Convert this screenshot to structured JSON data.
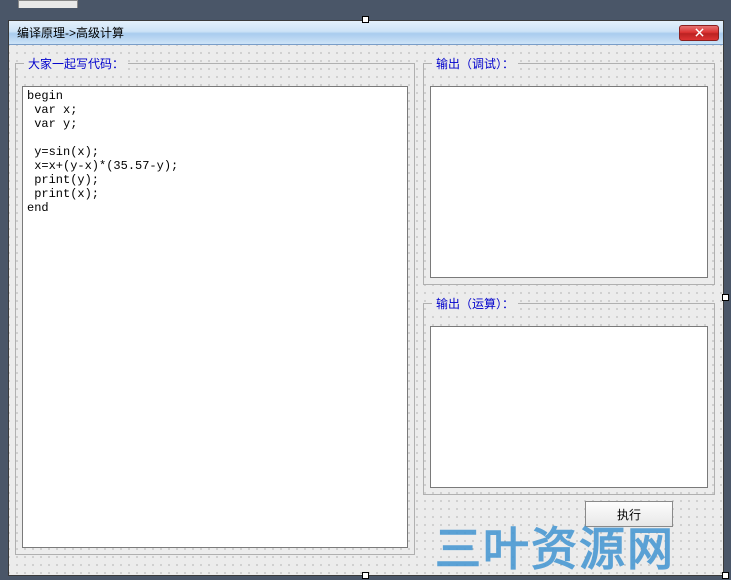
{
  "window": {
    "title": "编译原理->高级计算"
  },
  "groups": {
    "code": {
      "legend": "大家一起写代码："
    },
    "debug": {
      "legend": "输出（调试）："
    },
    "run": {
      "legend": "输出（运算）："
    }
  },
  "code_text": "begin\n var x;\n var y;\n\n y=sin(x);\n x=x+(y-x)*(35.57-y);\n print(y);\n print(x);\nend",
  "debug_text": "",
  "run_text": "",
  "buttons": {
    "execute": "执行"
  },
  "watermark": "三叶资源网"
}
